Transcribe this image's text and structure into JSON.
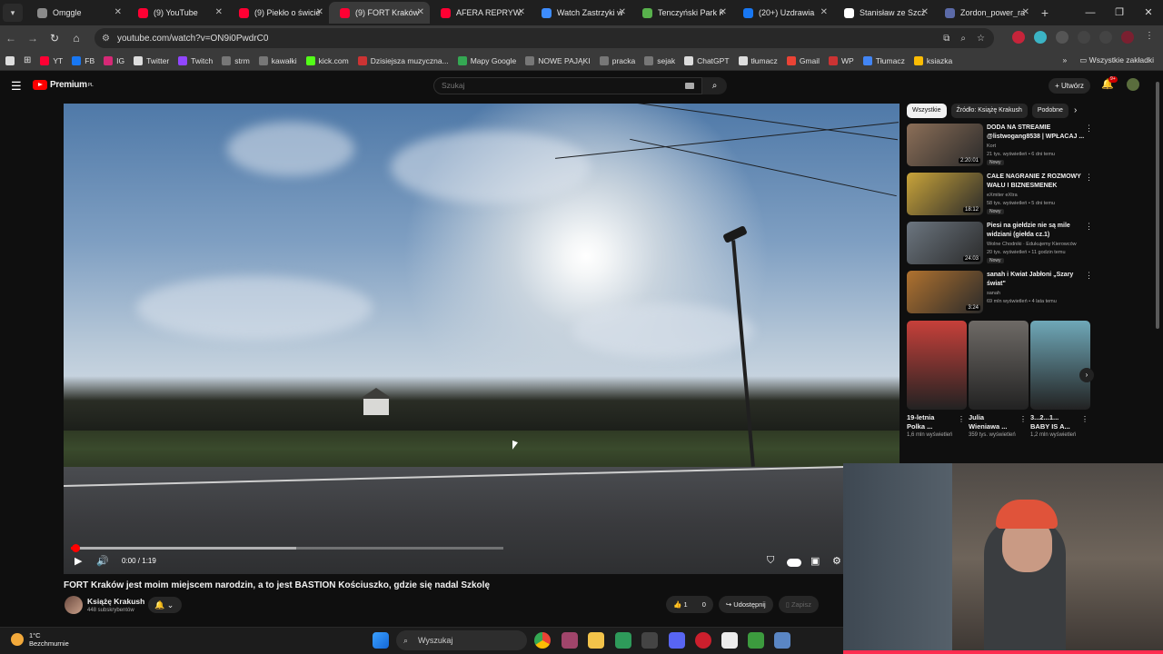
{
  "browser": {
    "tabs": [
      {
        "title": "Omggle",
        "color": "#8a8a8a"
      },
      {
        "title": "(9) YouTube",
        "color": "#ff0033"
      },
      {
        "title": "(9) Piekło o świcie",
        "color": "#ff0033"
      },
      {
        "title": "(9) FORT Kraków j",
        "color": "#ff0033",
        "active": true
      },
      {
        "title": "AFERA REPRYWAT",
        "color": "#ff0033"
      },
      {
        "title": "Watch Zastrzyki w",
        "color": "#3d8cff"
      },
      {
        "title": "Tenczyński Park K",
        "color": "#58b14c"
      },
      {
        "title": "(20+) Uzdrawia",
        "color": "#1877f2"
      },
      {
        "title": "Stanisław ze Szcz",
        "color": "#ffffff"
      },
      {
        "title": "Zordon_power_ra",
        "color": "#5b6aa8"
      }
    ],
    "url": "youtube.com/watch?v=ON9i0PwdrC0",
    "bookmarks": [
      {
        "label": "YT",
        "color": "#ff0033"
      },
      {
        "label": "FB",
        "color": "#1877f2"
      },
      {
        "label": "IG",
        "color": "#d62976"
      },
      {
        "label": "Twitter",
        "color": "#dddddd"
      },
      {
        "label": "Twitch",
        "color": "#9146ff"
      },
      {
        "label": "strm",
        "color": "#777777"
      },
      {
        "label": "kawałki",
        "color": "#777777"
      },
      {
        "label": "kick.com",
        "color": "#53fc18"
      },
      {
        "label": "Dzisiejsza muzyczna...",
        "color": "#cc3333"
      },
      {
        "label": "Mapy Google",
        "color": "#34a853"
      },
      {
        "label": "NOWE PAJĄKI",
        "color": "#777777"
      },
      {
        "label": "pracka",
        "color": "#777777"
      },
      {
        "label": "sejak",
        "color": "#777777"
      },
      {
        "label": "ChatGPT",
        "color": "#dddddd"
      },
      {
        "label": "tłumacz",
        "color": "#dddddd"
      },
      {
        "label": "Gmail",
        "color": "#ea4335"
      },
      {
        "label": "WP",
        "color": "#cc3333"
      },
      {
        "label": "Tłumacz",
        "color": "#4285f4"
      },
      {
        "label": "ksiazka",
        "color": "#fbbc04"
      }
    ],
    "all_bookmarks_label": "Wszystkie zakładki"
  },
  "youtube": {
    "logo_text": "Premium",
    "logo_sup": "PL",
    "search_placeholder": "Szukaj",
    "create_label": "Utwórz",
    "notification_count": "9+",
    "video": {
      "time": "0:00 / 1:19",
      "played_fraction": 0.01,
      "buffered_fraction": 0.52,
      "title": "FORT Kraków jest moim miejscem narodzin, a to jest BASTION Kościuszko, gdzie się nadal Szkolę",
      "channel": "Książę Krakush",
      "subscribers": "448 subskrybentów",
      "likes": "1",
      "dislikes": "0",
      "share_label": "Udostępnij",
      "save_label": "Zapisz"
    },
    "chips": [
      "Wszystkie",
      "Źródło: Książę Krakush",
      "Podobne"
    ],
    "recommendations": [
      {
        "title": "DODA NA STREAMIE @listwogang8538 | WPŁACAJ ...",
        "channel": "Kort",
        "meta": "21 tys. wyświetleń • 6 dni temu",
        "badge": "Nowy",
        "duration": "2:20:01",
        "thumb": "#8c6f58"
      },
      {
        "title": "CAŁE NAGRANIE Z ROZMOWY WAŁU I BIZNESMENEK",
        "channel": "eXmiter eXtra",
        "meta": "58 tys. wyświetleń • 5 dni temu",
        "badge": "Nowy",
        "duration": "18:12",
        "thumb": "#c9a43a"
      },
      {
        "title": "Piesi na giełdzie nie są mile widziani (giełda cz.1)",
        "channel": "Wolne Chodniki · Edukujemy Kierowców",
        "meta": "20 tys. wyświetleń • 11 godzin temu",
        "badge": "Nowy",
        "duration": "24:03",
        "thumb": "#6c7680"
      },
      {
        "title": "sanah i Kwiat Jabłoni „Szary świat\"",
        "channel": "sanah",
        "meta": "69 mln wyświetleń • 4 lata temu",
        "badge": "",
        "duration": "3:24",
        "thumb": "#b0722f"
      }
    ],
    "shorts": [
      {
        "title": "19-letnia Polka ...",
        "views": "1,6 mln wyświetleń",
        "color": "#c7403a"
      },
      {
        "title": "Julia Wieniawa ...",
        "views": "359 tys. wyświetleń",
        "color": "#6e6a66"
      },
      {
        "title": "3...2...1... BABY IS A...",
        "views": "1,2 mln wyświetleń",
        "color": "#6fa8b8"
      }
    ]
  },
  "taskbar": {
    "temperature": "1°C",
    "weather": "Bezchmurnie",
    "search_placeholder": "Wyszukaj"
  }
}
